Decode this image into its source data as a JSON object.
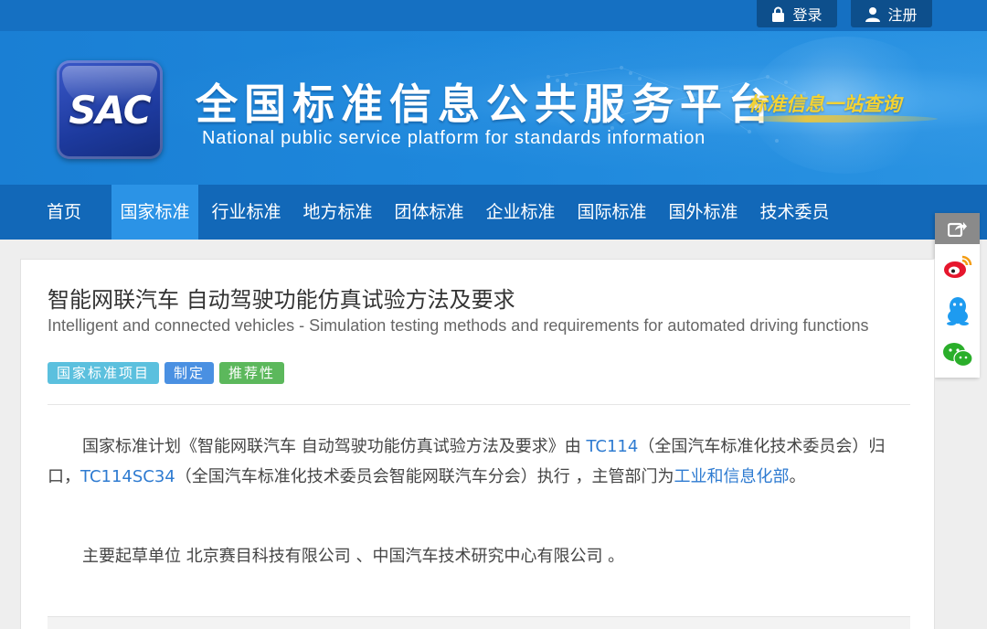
{
  "auth": {
    "login_label": "登录",
    "register_label": "注册"
  },
  "header": {
    "logo_text": "SAC",
    "title": "全国标准信息公共服务平台",
    "subtitle": "National public service platform  for standards information",
    "slogan": "标准信息一站查询"
  },
  "nav": {
    "items": [
      {
        "label": "首页",
        "active": false
      },
      {
        "label": "国家标准",
        "active": true
      },
      {
        "label": "行业标准",
        "active": false
      },
      {
        "label": "地方标准",
        "active": false
      },
      {
        "label": "团体标准",
        "active": false
      },
      {
        "label": "企业标准",
        "active": false
      },
      {
        "label": "国际标准",
        "active": false
      },
      {
        "label": "国外标准",
        "active": false
      },
      {
        "label": "技术委员",
        "active": false
      }
    ]
  },
  "share": {
    "icons": [
      "share-icon",
      "weibo-icon",
      "qq-icon",
      "wechat-icon"
    ],
    "colors": {
      "weibo": "#e6162d",
      "qq": "#1e9bf0",
      "wechat": "#2aae2a"
    }
  },
  "standard": {
    "title_cn": "智能网联汽车 自动驾驶功能仿真试验方法及要求",
    "title_en": "Intelligent and connected vehicles - Simulation testing methods and requirements for automated driving functions",
    "tags": [
      {
        "label": "国家标准项目",
        "color": "#5bc0de"
      },
      {
        "label": "制定",
        "color": "#4a90e2"
      },
      {
        "label": "推荐性",
        "color": "#5cb85c"
      }
    ],
    "desc": {
      "p1_a": "国家标准计划《智能网联汽车 自动驾驶功能仿真试验方法及要求》由 ",
      "tc1": "TC114",
      "p1_b": "（全国汽车标准化技术委员会）归口，",
      "tc2": "TC114SC34",
      "p1_c": "（全国汽车标准化技术委员会智能网联汽车分会）执行 ，主管部门为",
      "dept": "工业和信息化部",
      "p1_d": "。",
      "p2": "主要起草单位 北京赛目科技有限公司 、中国汽车技术研究中心有限公司 。"
    }
  }
}
